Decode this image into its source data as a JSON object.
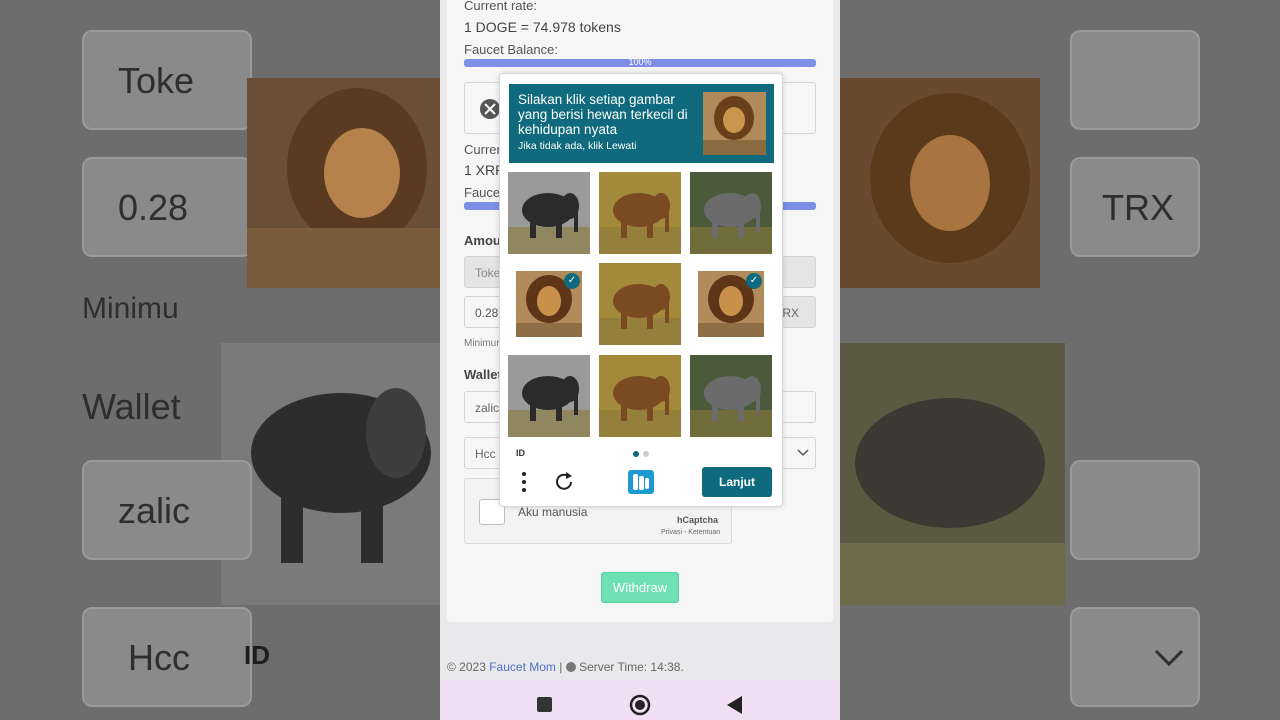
{
  "background_left": {
    "label_token": "Toke",
    "label_amount": "0.28",
    "label_minimum": "Minimu",
    "label_wallet": "Wallet",
    "label_address": "zalic",
    "label_hcc": "Hcc"
  },
  "background_right": {
    "label_currency": "TRX",
    "label_id": "ID"
  },
  "faucet": {
    "current_rate_label": "Current rate:",
    "current_rate_value": "1 DOGE = 74.978 tokens",
    "balance_label": "Faucet Balance:",
    "balance_percent_text": "100%",
    "balance_fraction": 1.0,
    "second_rate_label": "Curren",
    "second_rate_value": "1 XRP",
    "second_balance_label": "Fauce",
    "amount_label": "Amou",
    "token_field": "Toke",
    "amount_field": "0.28",
    "currency_suffix": "TRX",
    "minimum_text": "Minimum",
    "wallet_label": "Wallet",
    "wallet_field": "zalic",
    "select_field": "Hcc",
    "withdraw_label": "Withdraw"
  },
  "hcaptcha_widget": {
    "checkbox_label": "Aku manusia",
    "brand": "hCaptcha",
    "links": "Privasi - Ketentuan"
  },
  "captcha": {
    "prompt_title": "Silakan klik setiap gambar yang berisi hewan terkecil di kehidupan nyata",
    "prompt_subtitle": "Jika tidak ada, klik Lewati",
    "tiles": [
      {
        "subject": "elephant",
        "selected": false
      },
      {
        "subject": "elephant",
        "selected": false
      },
      {
        "subject": "elephant",
        "selected": false
      },
      {
        "subject": "lion",
        "selected": true
      },
      {
        "subject": "elephant",
        "selected": false
      },
      {
        "subject": "lion",
        "selected": true
      },
      {
        "subject": "elephant",
        "selected": false
      },
      {
        "subject": "elephant",
        "selected": false
      },
      {
        "subject": "elephant",
        "selected": false
      }
    ],
    "language": "ID",
    "next_button": "Lanjut",
    "icons": [
      "menu-dots-icon",
      "refresh-icon",
      "hcaptcha-logo-icon"
    ]
  },
  "footer": {
    "copyright": "© 2023",
    "site_name": "Faucet Mom",
    "separator": "|",
    "server_time": "Server Time: 14:38."
  },
  "navbar": {
    "icons": [
      "recent-apps-icon",
      "home-icon",
      "back-icon"
    ]
  },
  "colors": {
    "captcha_teal": "#0e6a7c",
    "balance_bar": "#7c8ee6",
    "withdraw_green": "#6fe0b4",
    "link_blue": "#4e6fc2"
  }
}
